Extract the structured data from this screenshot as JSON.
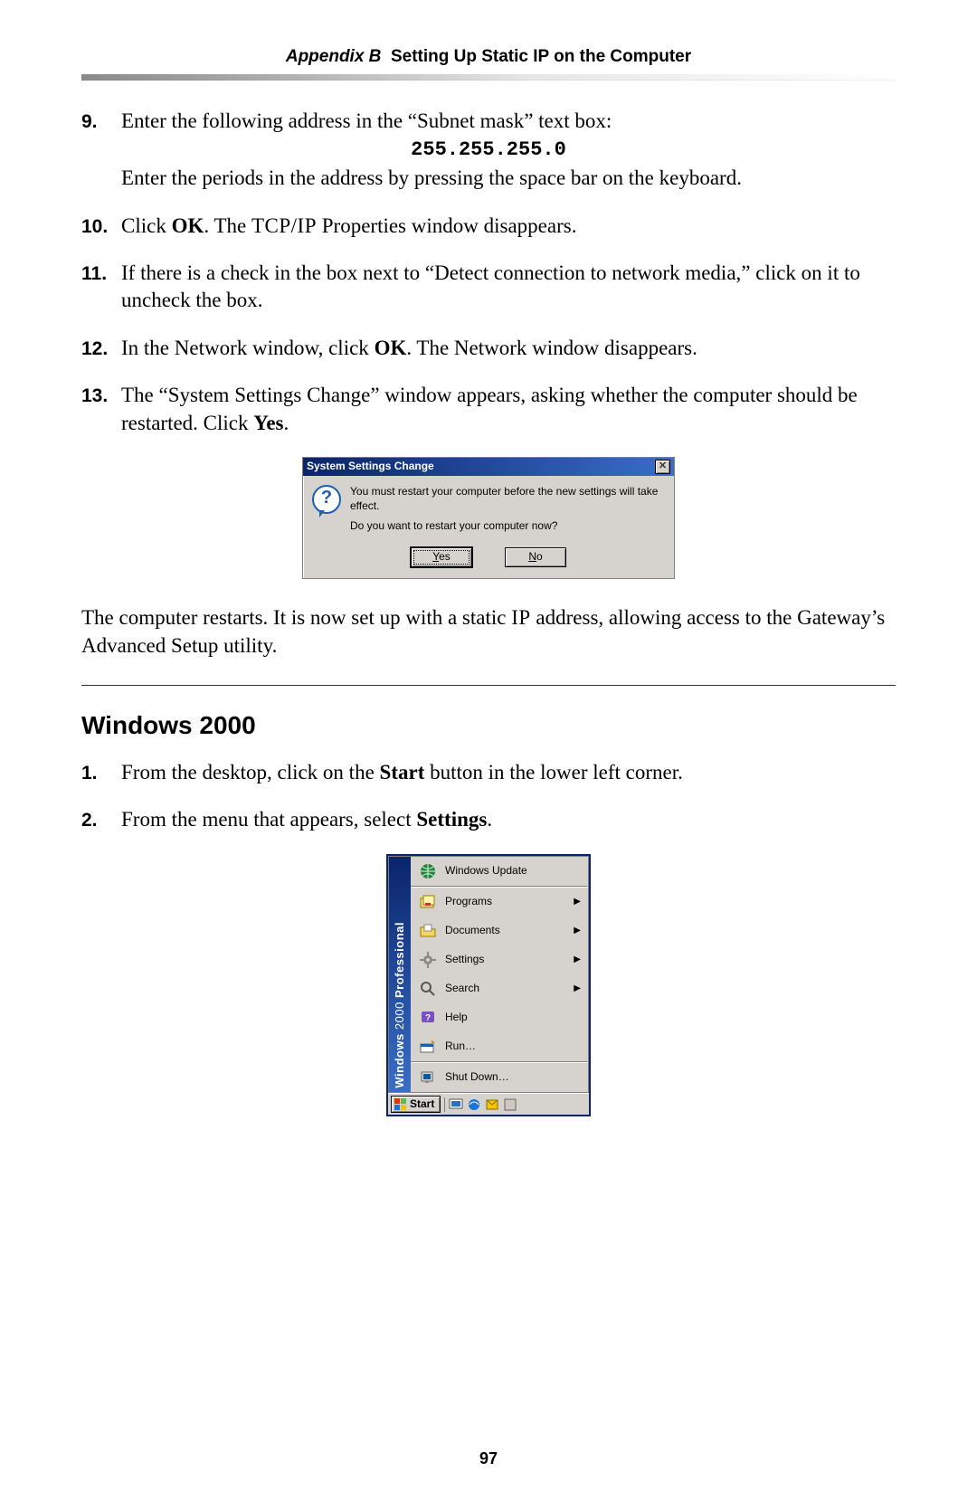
{
  "header": {
    "appendix": "Appendix B",
    "title": "Setting Up Static IP on the Computer"
  },
  "steps_a": [
    {
      "num": "9.",
      "pre": "Enter the following address in the “Subnet mask” text box:",
      "code": "255.255.255.0",
      "post": "Enter the periods in the address by pressing the space bar on the keyboard."
    },
    {
      "num": "10.",
      "text_a": "Click ",
      "ok": "OK",
      "text_b": ". The ",
      "sc": "TCP/IP",
      "text_c": " Properties window disappears."
    },
    {
      "num": "11.",
      "text": "If there is a check in the box next to “Detect connection to network media,” click on it to uncheck the box."
    },
    {
      "num": "12.",
      "text_a": "In the Network window, click ",
      "ok": "OK",
      "text_b": ". The Network window disappears."
    },
    {
      "num": "13.",
      "text_a": "The “System Settings Change” window appears, asking whether the computer should be restarted. Click ",
      "yes": "Yes",
      "text_b": "."
    }
  ],
  "dialog": {
    "title": "System Settings Change",
    "line1": "You must restart your computer before the new settings will take effect.",
    "line2": "Do you want to restart your computer now?",
    "yes_u": "Y",
    "yes_rest": "es",
    "no_u": "N",
    "no_rest": "o",
    "close_glyph": "✕"
  },
  "after_dialog_a": "The computer restarts. It is now set up with a static ",
  "after_dialog_sc": "IP",
  "after_dialog_b": " address, allowing access to the Gateway’s Advanced Setup utility.",
  "section_title": "Windows 2000",
  "steps_b": [
    {
      "num": "1.",
      "a": "From the desktop, click on the ",
      "bold": "Start",
      "b": " button in the lower left corner."
    },
    {
      "num": "2.",
      "a": "From the menu that appears, select ",
      "bold": "Settings",
      "b": "."
    }
  ],
  "startmenu": {
    "side_a": "Windows",
    "side_b": "2000",
    "side_c": "Professional",
    "items": [
      {
        "label": "Windows Update",
        "icon": "globe",
        "arrow": false
      },
      {
        "label": "Programs",
        "icon": "folder-pg",
        "arrow": true
      },
      {
        "label": "Documents",
        "icon": "folder-doc",
        "arrow": true
      },
      {
        "label": "Settings",
        "icon": "gear",
        "arrow": true
      },
      {
        "label": "Search",
        "icon": "search",
        "arrow": true
      },
      {
        "label": "Help",
        "icon": "help",
        "arrow": false
      },
      {
        "label": "Run…",
        "icon": "run",
        "arrow": false
      },
      {
        "label": "Shut Down…",
        "icon": "shutdown",
        "arrow": false
      }
    ],
    "start_label": "Start"
  },
  "page_number": "97"
}
